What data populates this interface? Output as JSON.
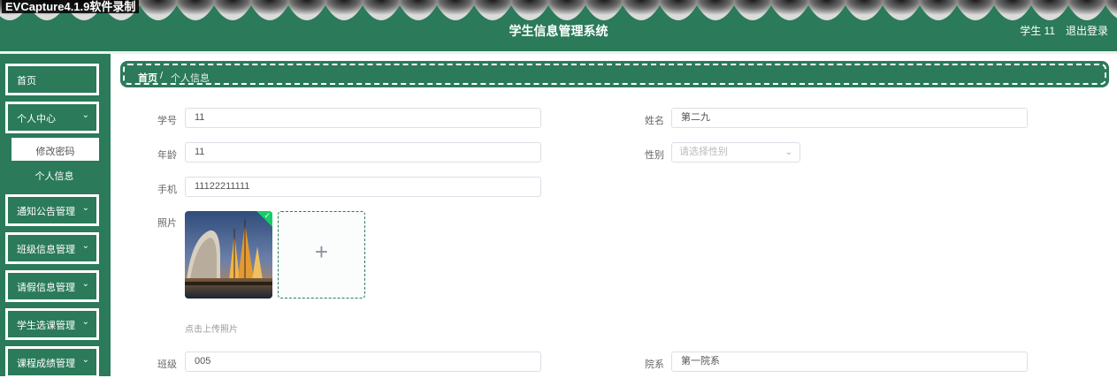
{
  "watermark": "EVCapture4.1.9软件录制",
  "header": {
    "title": "学生信息管理系统",
    "user": "学生 11",
    "logout": "退出登录"
  },
  "sidebar": {
    "items": [
      {
        "label": "首页",
        "has_chevron": false
      },
      {
        "label": "个人中心",
        "has_chevron": true
      },
      {
        "label": "通知公告管理",
        "has_chevron": true
      },
      {
        "label": "班级信息管理",
        "has_chevron": true
      },
      {
        "label": "请假信息管理",
        "has_chevron": true
      },
      {
        "label": "学生选课管理",
        "has_chevron": true
      },
      {
        "label": "课程成绩管理",
        "has_chevron": true
      }
    ],
    "submenu": [
      {
        "label": "修改密码",
        "active": true
      },
      {
        "label": "个人信息",
        "active": false
      }
    ]
  },
  "breadcrumb": {
    "home": "首页",
    "separator": "/",
    "current": "个人信息"
  },
  "form": {
    "student_id": {
      "label": "学号",
      "value": "11"
    },
    "name": {
      "label": "姓名",
      "value": "第二九"
    },
    "age": {
      "label": "年龄",
      "value": "11"
    },
    "gender": {
      "label": "性别",
      "placeholder": "请选择性别"
    },
    "phone": {
      "label": "手机",
      "value": "11122211111"
    },
    "photo": {
      "label": "照片",
      "tip": "点击上传照片"
    },
    "class": {
      "label": "班级",
      "value": "005"
    },
    "college": {
      "label": "院系",
      "value": "第一院系"
    }
  },
  "colors": {
    "primary": "#2b7a5a",
    "upload_ok": "#13ce66"
  },
  "icons": {
    "chevron": "chevron-down-icon",
    "plus": "plus-icon",
    "check": "check-icon"
  }
}
